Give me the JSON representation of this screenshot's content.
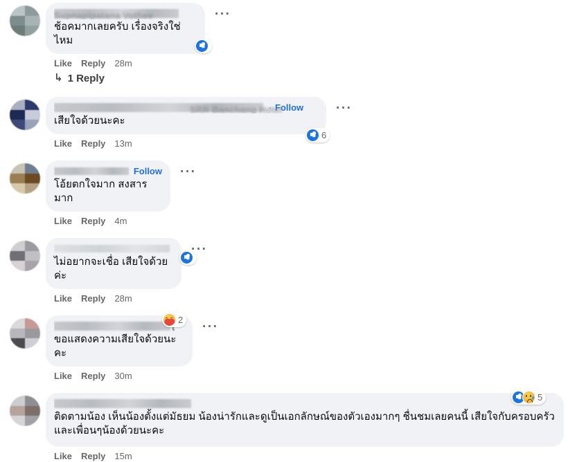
{
  "app": {
    "context": "facebook-comments-thread",
    "bubble_color": "#f0f2f5",
    "link_color": "#216fdb",
    "meta_color": "#65676b",
    "like_blue": "#1b74e4"
  },
  "labels": {
    "like": "Like",
    "reply": "Reply",
    "follow": "Follow",
    "kebab": "···",
    "reply_arrow": "↳",
    "dot": "·"
  },
  "comments": [
    {
      "id": "c1",
      "author_visible": "Supnapipatana Vothee",
      "author_redacted": true,
      "has_follow": false,
      "text": "ช้อคมากเลยครับ เรื่องจริงใช่ไหม",
      "timestamp": "28m",
      "reactions": {
        "emojis": [
          "like"
        ],
        "count": ""
      },
      "replies_label": "1 Reply",
      "avatar_colors": [
        "#b9c4c6",
        "#8f9a9c",
        "#7c8d8d",
        "#a8b4b4",
        "#6e7d78",
        "#93a0a0"
      ]
    },
    {
      "id": "c2",
      "author_visible": "SRR Banchang Hotel",
      "author_redacted": true,
      "has_follow": true,
      "text": "เสียใจด้วยนะคะ",
      "timestamp": "13m",
      "reactions": {
        "emojis": [
          "like"
        ],
        "count": "6"
      },
      "replies_label": "",
      "avatar_colors": [
        "#aab0c2",
        "#2b3a6b",
        "#1e2a56",
        "#c8ccd8",
        "#3c4a7a",
        "#9aa2b8"
      ]
    },
    {
      "id": "c3",
      "author_visible": "",
      "author_redacted": true,
      "has_follow": true,
      "text": "โอ้ยตกใจมาก สงสารมาก",
      "timestamp": "4m",
      "reactions": {
        "emojis": [],
        "count": ""
      },
      "replies_label": "",
      "avatar_colors": [
        "#c9c3b4",
        "#6e7f94",
        "#9a7f55",
        "#6b4a24",
        "#d8c9ab",
        "#b6a184"
      ]
    },
    {
      "id": "c4",
      "author_visible": "",
      "author_redacted": true,
      "has_follow": false,
      "text": "ไม่อยากจะเชื่อ เสียใจด้วยค่ะ",
      "timestamp": "28m",
      "reactions": {
        "emojis": [
          "like"
        ],
        "count": ""
      },
      "replies_label": "",
      "avatar_colors": [
        "#cfcfd1",
        "#9b9ba0",
        "#6f7075",
        "#bfbfc4",
        "#d9d2d4",
        "#a6a4a9"
      ]
    },
    {
      "id": "c5",
      "author_visible": "t",
      "author_redacted": true,
      "has_follow": false,
      "text": "ขอแสดงความเสียใจด้วยนะคะ",
      "timestamp": "30m",
      "reactions": {
        "emojis": [
          "care"
        ],
        "count": "2"
      },
      "replies_label": "",
      "avatar_colors": [
        "#dadada",
        "#c79a93",
        "#b8b8bc",
        "#9a9a9e",
        "#4c4c50",
        "#cfcfd2"
      ]
    },
    {
      "id": "c6",
      "author_visible": "",
      "author_redacted": true,
      "has_follow": false,
      "text": "ติดตามน้อง เห็นน้องตั้งแต่มัธยม น้องน่ารักและดูเป็นเอกลักษณ์ของตัวเองมากๆ ชื่นชมเลยคนนี้ เสียใจกับครอบครัวและเพื่อนๆน้องด้วยนะคะ",
      "timestamp": "15m",
      "reactions": {
        "emojis": [
          "like",
          "sad"
        ],
        "count": "5"
      },
      "replies_label": "",
      "avatar_colors": [
        "#cdcdd0",
        "#8d8f93",
        "#b6a49c",
        "#7d6f69",
        "#d5d5d8",
        "#a3a3a7"
      ]
    }
  ]
}
